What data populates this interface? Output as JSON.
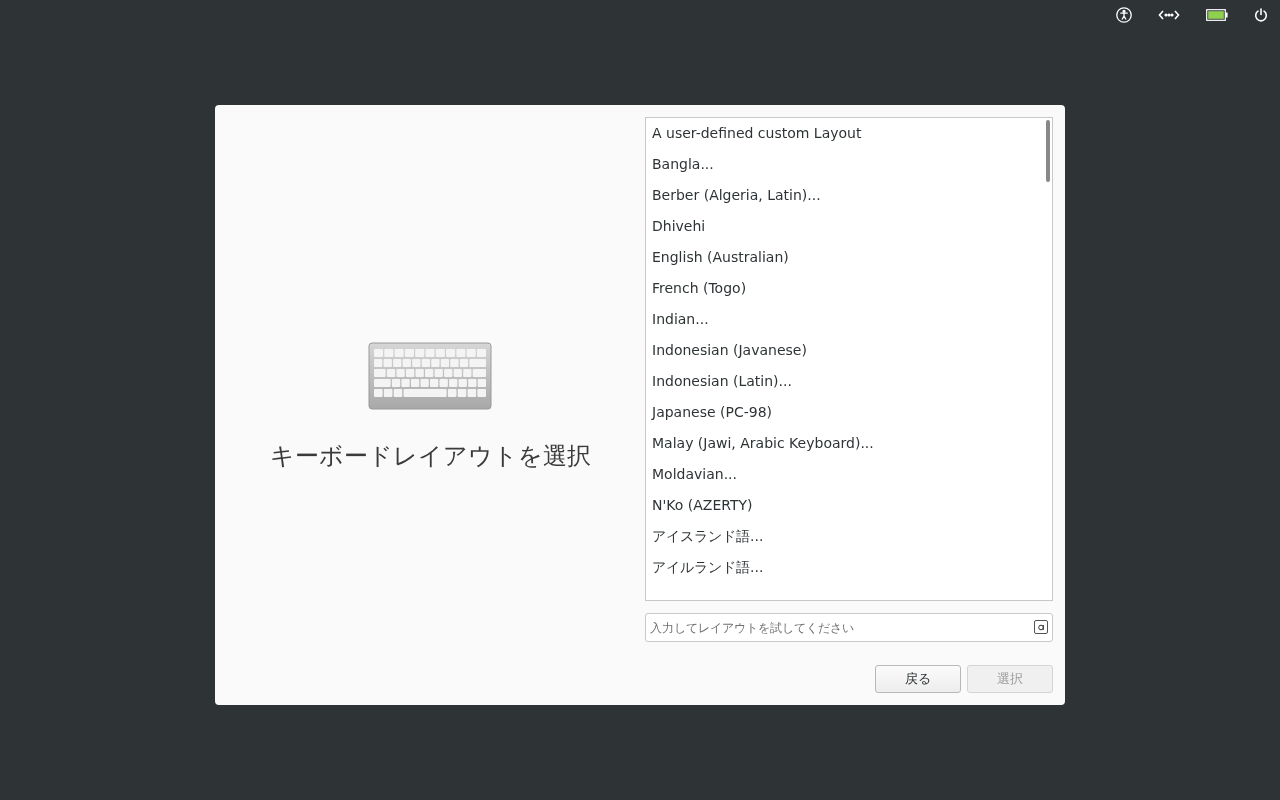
{
  "dialog": {
    "title": "キーボードレイアウトを選択",
    "layouts": [
      {
        "label": "A user-defined custom Layout",
        "selected": false
      },
      {
        "label": "Bangla...",
        "selected": false
      },
      {
        "label": "Berber (Algeria, Latin)...",
        "selected": false
      },
      {
        "label": "Dhivehi",
        "selected": false
      },
      {
        "label": "English (Australian)",
        "selected": false
      },
      {
        "label": "French (Togo)",
        "selected": false
      },
      {
        "label": "Indian...",
        "selected": false
      },
      {
        "label": "Indonesian (Javanese)",
        "selected": false
      },
      {
        "label": "Indonesian (Latin)...",
        "selected": false
      },
      {
        "label": "Japanese (PC-98)",
        "selected": false
      },
      {
        "label": "Malay (Jawi, Arabic Keyboard)...",
        "selected": false
      },
      {
        "label": "Moldavian...",
        "selected": false
      },
      {
        "label": "N'Ko (AZERTY)",
        "selected": false
      },
      {
        "label": "アイスランド語...",
        "selected": false
      },
      {
        "label": "アイルランド語...",
        "selected": false
      }
    ],
    "test_field": {
      "placeholder": "入力してレイアウトを試してください"
    },
    "buttons": [
      {
        "label": "戻る",
        "disabled": false
      },
      {
        "label": "選択",
        "disabled": true
      }
    ]
  }
}
